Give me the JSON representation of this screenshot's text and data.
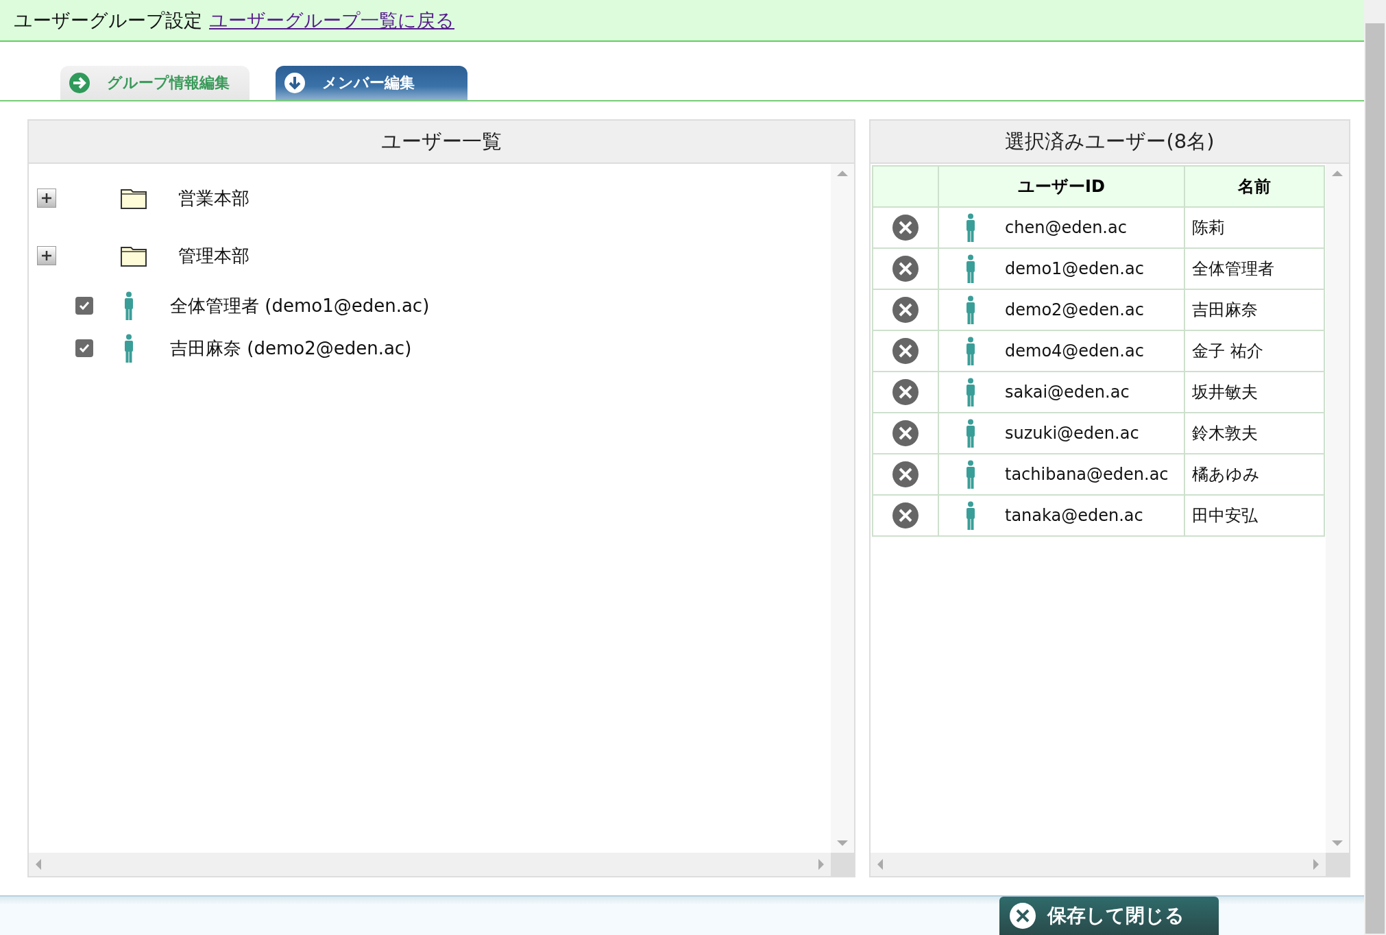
{
  "header": {
    "title": "ユーザーグループ設定",
    "back_link": "ユーザーグループ一覧に戻る"
  },
  "tabs": [
    {
      "label": "グループ情報編集",
      "selected": false
    },
    {
      "label": "メンバー編集",
      "selected": true
    }
  ],
  "user_list": {
    "title": "ユーザー一覧",
    "items": [
      {
        "kind": "folder",
        "label": "営業本部",
        "expanded": false
      },
      {
        "kind": "folder",
        "label": "管理本部",
        "expanded": false
      },
      {
        "kind": "user",
        "label": "全体管理者 (demo1@eden.ac)",
        "checked": true
      },
      {
        "kind": "user",
        "label": "吉田麻奈 (demo2@eden.ac)",
        "checked": true
      }
    ]
  },
  "selected_users": {
    "title": "選択済みユーザー(8名)",
    "columns": [
      "ユーザーID",
      "名前"
    ],
    "rows": [
      {
        "user_id": "chen@eden.ac",
        "name": "陈莉"
      },
      {
        "user_id": "demo1@eden.ac",
        "name": "全体管理者"
      },
      {
        "user_id": "demo2@eden.ac",
        "name": "吉田麻奈"
      },
      {
        "user_id": "demo4@eden.ac",
        "name": "金子 祐介"
      },
      {
        "user_id": "sakai@eden.ac",
        "name": "坂井敏夫"
      },
      {
        "user_id": "suzuki@eden.ac",
        "name": "鈴木敦夫"
      },
      {
        "user_id": "tachibana@eden.ac",
        "name": "橘あゆみ"
      },
      {
        "user_id": "tanaka@eden.ac",
        "name": "田中安弘"
      }
    ]
  },
  "footer": {
    "save_button": "保存して閉じる"
  }
}
